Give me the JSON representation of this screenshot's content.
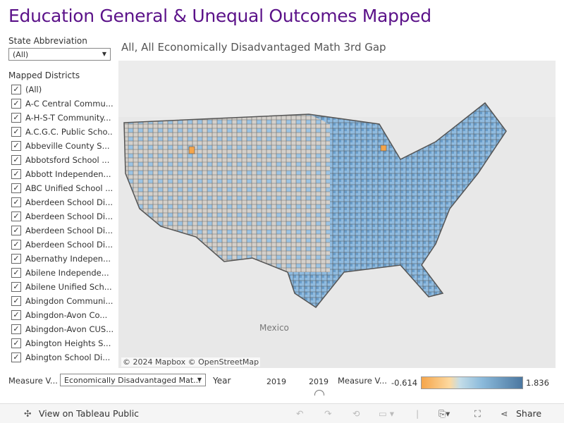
{
  "title": "Education General & Unequal Outcomes Mapped",
  "filters": {
    "state_label": "State Abbreviation",
    "state_value": "(All)",
    "districts_label": "Mapped Districts",
    "districts": [
      "(All)",
      "A-C Central Commu...",
      "A-H-S-T Community...",
      "A.C.G.C. Public Scho...",
      "Abbeville County S...",
      "Abbotsford School ...",
      "Abbott Independen...",
      "ABC Unified School ...",
      "Aberdeen School Di...",
      "Aberdeen School Di...",
      "Aberdeen School Di...",
      "Aberdeen School Di...",
      "Abernathy Indepen...",
      "Abilene Independe...",
      "Abilene Unified Sch...",
      "Abingdon Communi...",
      "Abingdon-Avon Co...",
      "Abingdon-Avon CUS...",
      "Abington Heights S...",
      "Abington School Di..."
    ]
  },
  "sheet_title": "All, All Economically Disadvantaged Math 3rd Gap",
  "map": {
    "attribution": "© 2024 Mapbox  © OpenStreetMap",
    "country_label": "Mexico",
    "fill_colors": {
      "gray": "#d4d0cb",
      "light_blue": "#9cc4e4",
      "blue": "#6a9ecb",
      "orange": "#f5a54a",
      "border": "#555555"
    }
  },
  "controls": {
    "measure_label": "Measure V...",
    "measure_value": "Economically Disadvantaged Mat...",
    "year_label": "Year",
    "year_min": "2019",
    "year_max": "2019",
    "legend_label": "Measure V...",
    "legend_min": "-0.614",
    "legend_max": "1.836"
  },
  "toolbar": {
    "view_label": "View on Tableau Public",
    "share_label": "Share"
  }
}
